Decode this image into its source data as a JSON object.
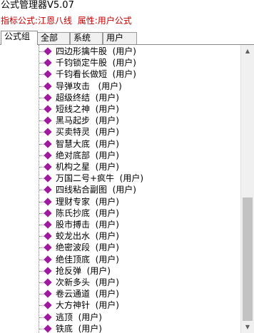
{
  "window": {
    "title": "公式管理器V5.07"
  },
  "info": {
    "formula_label": "指标公式:",
    "formula_name": "江恩八线",
    "attr_label": "属性:",
    "attr_value": "用户公式"
  },
  "tabs": [
    {
      "label": "公式组",
      "active": true
    },
    {
      "label": "全部",
      "active": false
    },
    {
      "label": "系统",
      "active": false
    },
    {
      "label": "用户",
      "active": false
    }
  ],
  "tree": {
    "items": [
      "四边形擒牛股  (用户)",
      "千钧锁定牛股  (用户)",
      "千钧看长做短  (用户)",
      "导弹攻击   (用户)",
      "超级终结  (用户)",
      "短线之神  (用户)",
      "黑马起步  (用户)",
      "买卖特灵  (用户)",
      "智慧大底  (用户)",
      "绝对底部  (用户)",
      "机构之星  (用户)",
      "万国二号+疯牛  (用户)",
      "四线粘合副图  (用户)",
      "理财专家  (用户)",
      "陈氏抄底  (用户)",
      "股市搏击  (用户)",
      "蛟龙出水  (用户)",
      "绝密波段  (用户)",
      "绝佳顶底  (用户)",
      "抢反弹  (用户)",
      "次新多头  (用户)",
      "卷云通道  (用户)",
      "大方神针  (用户)",
      "逃顶  (用户)",
      "铁底  (用户)"
    ]
  },
  "icons": {
    "tree_item": "diamond-icon",
    "scroll_up": "arrow-up-icon",
    "scroll_down": "arrow-down-icon"
  },
  "colors": {
    "info_text": "#c00000",
    "diamond": "#a01aa0",
    "scroll_thumb": "#c2c2c2"
  }
}
